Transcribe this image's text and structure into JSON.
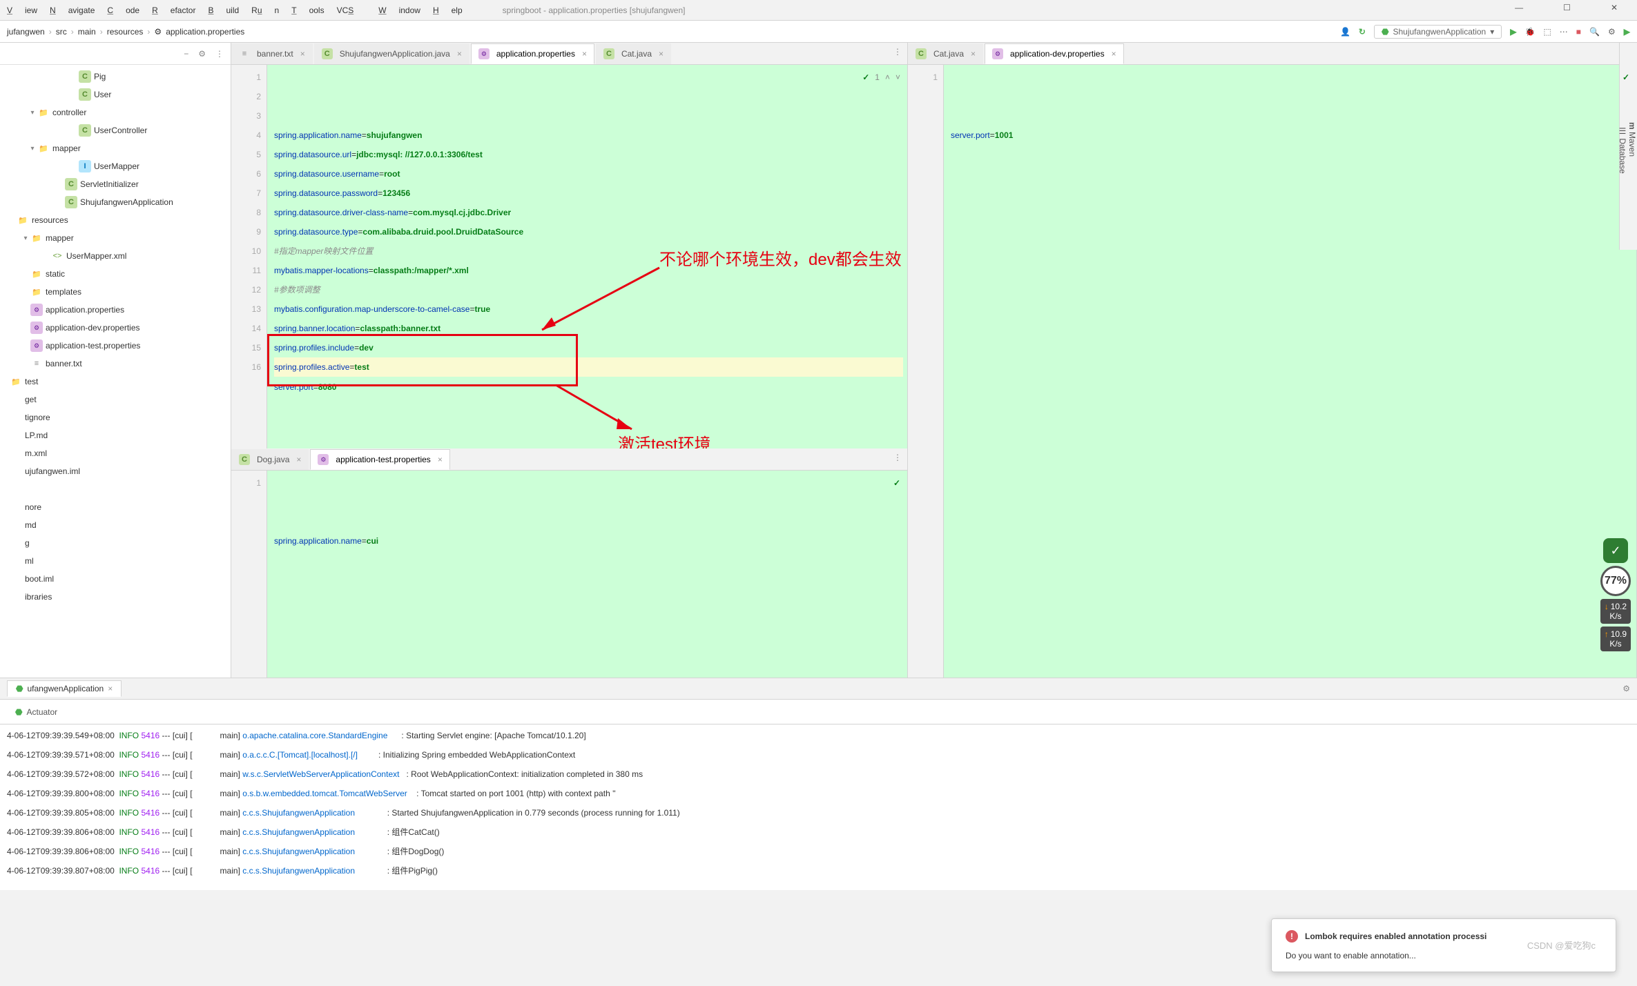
{
  "menubar": {
    "items": [
      "View",
      "Navigate",
      "Code",
      "Refactor",
      "Build",
      "Run",
      "Tools",
      "VCS",
      "Window",
      "Help"
    ],
    "title": "springboot - application.properties [shujufangwen]"
  },
  "win_controls": {
    "min": "—",
    "max": "☐",
    "close": "✕"
  },
  "breadcrumb": {
    "items": [
      "jufangwen",
      "src",
      "main",
      "resources",
      "application.properties"
    ],
    "icon": "⚙"
  },
  "toolbar": {
    "run_config": "ShujufangwenApplication",
    "icons": [
      "▶",
      "⟳",
      "⤓",
      "⋯",
      "■",
      "🔍",
      "⚙",
      "▶"
    ]
  },
  "tree": {
    "header_icons": [
      "−",
      "⚙",
      "⋮"
    ],
    "items": [
      {
        "indent": 100,
        "icon": "C",
        "iconClass": "ic-class",
        "label": "Pig"
      },
      {
        "indent": 100,
        "icon": "C",
        "iconClass": "ic-class",
        "label": "User"
      },
      {
        "indent": 40,
        "exp": "▾",
        "icon": "📁",
        "iconClass": "ic-pkg",
        "label": "controller"
      },
      {
        "indent": 100,
        "icon": "C",
        "iconClass": "ic-class",
        "label": "UserController"
      },
      {
        "indent": 40,
        "exp": "▾",
        "icon": "📁",
        "iconClass": "ic-pkg",
        "label": "mapper"
      },
      {
        "indent": 100,
        "icon": "I",
        "iconClass": "ic-interface",
        "label": "UserMapper"
      },
      {
        "indent": 80,
        "icon": "C",
        "iconClass": "ic-class",
        "label": "ServletInitializer"
      },
      {
        "indent": 80,
        "icon": "C",
        "iconClass": "ic-class",
        "label": "ShujufangwenApplication"
      },
      {
        "indent": 10,
        "exp": "",
        "icon": "📁",
        "iconClass": "ic-folder",
        "label": "resources",
        "sel": false,
        "resourceRoot": true
      },
      {
        "indent": 30,
        "exp": "▾",
        "icon": "📁",
        "iconClass": "ic-folder",
        "label": "mapper"
      },
      {
        "indent": 60,
        "icon": "<>",
        "iconClass": "ic-xml",
        "label": "UserMapper.xml"
      },
      {
        "indent": 30,
        "icon": "📁",
        "iconClass": "ic-folder",
        "label": "static"
      },
      {
        "indent": 30,
        "icon": "📁",
        "iconClass": "ic-folder",
        "label": "templates"
      },
      {
        "indent": 30,
        "icon": "⚙",
        "iconClass": "ic-prop",
        "label": "application.properties"
      },
      {
        "indent": 30,
        "icon": "⚙",
        "iconClass": "ic-prop",
        "label": "application-dev.properties"
      },
      {
        "indent": 30,
        "icon": "⚙",
        "iconClass": "ic-prop",
        "label": "application-test.properties"
      },
      {
        "indent": 30,
        "icon": "≡",
        "iconClass": "ic-txt",
        "label": "banner.txt"
      },
      {
        "indent": 0,
        "icon": "📁",
        "iconClass": "ic-folder",
        "label": "test"
      },
      {
        "indent": 0,
        "icon": "",
        "iconClass": "",
        "label": "get"
      },
      {
        "indent": 0,
        "icon": "",
        "iconClass": "",
        "label": "tignore"
      },
      {
        "indent": 0,
        "icon": "",
        "iconClass": "",
        "label": "LP.md"
      },
      {
        "indent": 0,
        "icon": "",
        "iconClass": "",
        "label": "m.xml"
      },
      {
        "indent": 0,
        "icon": "",
        "iconClass": "",
        "label": "ujufangwen.iml"
      },
      {
        "indent": 0,
        "icon": "",
        "iconClass": "",
        "label": ""
      },
      {
        "indent": 0,
        "icon": "",
        "iconClass": "",
        "label": "nore"
      },
      {
        "indent": 0,
        "icon": "",
        "iconClass": "",
        "label": "md"
      },
      {
        "indent": 0,
        "icon": "",
        "iconClass": "",
        "label": "g"
      },
      {
        "indent": 0,
        "icon": "",
        "iconClass": "",
        "label": "ml"
      },
      {
        "indent": 0,
        "icon": "",
        "iconClass": "",
        "label": "boot.iml"
      },
      {
        "indent": 0,
        "icon": "",
        "iconClass": "",
        "label": "ibraries"
      }
    ]
  },
  "tabs_left": [
    {
      "icon": "≡",
      "label": "banner.txt",
      "active": false
    },
    {
      "icon": "C",
      "label": "ShujufangwenApplication.java",
      "active": false
    },
    {
      "icon": "⚙",
      "label": "application.properties",
      "active": true
    },
    {
      "icon": "C",
      "label": "Cat.java",
      "active": false
    }
  ],
  "tabs_right": [
    {
      "icon": "C",
      "label": "Cat.java",
      "active": false
    },
    {
      "icon": "⚙",
      "label": "application-dev.properties",
      "active": true
    }
  ],
  "tabs_bottom": [
    {
      "icon": "C",
      "label": "Dog.java",
      "active": false
    },
    {
      "icon": "⚙",
      "label": "application-test.properties",
      "active": true
    }
  ],
  "code_main": {
    "status": {
      "check": "✓",
      "count": "1",
      "up": "˄",
      "down": "˅"
    },
    "lines": [
      {
        "n": 1,
        "k": "spring.application.name",
        "v": "shujufangwen"
      },
      {
        "n": 2,
        "k": "spring.datasource.url",
        "v": "jdbc:mysql: //127.0.0.1:3306/test"
      },
      {
        "n": 3,
        "k": "spring.datasource.username",
        "v": "root"
      },
      {
        "n": 4,
        "k": "spring.datasource.password",
        "v": "123456"
      },
      {
        "n": 5,
        "k": "spring.datasource.driver-class-name",
        "v": "com.mysql.cj.jdbc.Driver"
      },
      {
        "n": 6,
        "k": "spring.datasource.type",
        "v": "com.alibaba.druid.pool.DruidDataSource"
      },
      {
        "n": 7,
        "comment": "#指定mapper映射文件位置"
      },
      {
        "n": 8,
        "k": "mybatis.mapper-locations",
        "v": "classpath:/mapper/*.xml"
      },
      {
        "n": 9,
        "comment": "#参数项调整"
      },
      {
        "n": 10,
        "k": "mybatis.configuration.map-underscore-to-camel-case",
        "v": "true"
      },
      {
        "n": 11,
        "k": "spring.banner.location",
        "v": "classpath:banner.txt"
      },
      {
        "n": 12,
        "k": "spring.profiles.include",
        "v": "dev"
      },
      {
        "n": 13,
        "k": "spring.profiles.active",
        "v": "test",
        "current": true
      },
      {
        "n": 14,
        "k": "server.port",
        "v": "8080"
      },
      {
        "n": 15,
        "blank": true
      },
      {
        "n": 16,
        "blank": true
      }
    ]
  },
  "code_right": {
    "lines": [
      {
        "n": 1,
        "k": "server.port",
        "v": "1001"
      }
    ],
    "check": "✓"
  },
  "code_bottom": {
    "lines": [
      {
        "n": 1,
        "k": "spring.application.name",
        "v": "cui"
      }
    ],
    "check": "✓"
  },
  "annotations": {
    "text1": "不论哪个环境生效，dev都会生效",
    "text2": "激活test环境"
  },
  "run_tab": {
    "label": "ufangwenApplication"
  },
  "status_tab": {
    "icon": "⬣",
    "label": "Actuator"
  },
  "console": {
    "rows": [
      {
        "t": "4-06-12T09:39:39.549+08:00",
        "lv": "INFO",
        "pid": "5416",
        "th": "--- [cui] [",
        "thr": "main]",
        "lg": "o.apache.catalina.core.StandardEngine",
        "m": ": Starting Servlet engine: [Apache Tomcat/10.1.20]"
      },
      {
        "t": "4-06-12T09:39:39.571+08:00",
        "lv": "INFO",
        "pid": "5416",
        "th": "--- [cui] [",
        "thr": "main]",
        "lg": "o.a.c.c.C.[Tomcat].[localhost].[/]",
        "m": ": Initializing Spring embedded WebApplicationContext"
      },
      {
        "t": "4-06-12T09:39:39.572+08:00",
        "lv": "INFO",
        "pid": "5416",
        "th": "--- [cui] [",
        "thr": "main]",
        "lg": "w.s.c.ServletWebServerApplicationContext",
        "m": ": Root WebApplicationContext: initialization completed in 380 ms"
      },
      {
        "t": "4-06-12T09:39:39.800+08:00",
        "lv": "INFO",
        "pid": "5416",
        "th": "--- [cui] [",
        "thr": "main]",
        "lg": "o.s.b.w.embedded.tomcat.TomcatWebServer",
        "m": ": Tomcat started on port 1001 (http) with context path ''"
      },
      {
        "t": "4-06-12T09:39:39.805+08:00",
        "lv": "INFO",
        "pid": "5416",
        "th": "--- [cui] [",
        "thr": "main]",
        "lg": "c.c.s.ShujufangwenApplication",
        "m": ": Started ShujufangwenApplication in 0.779 seconds (process running for 1.011)"
      },
      {
        "t": "4-06-12T09:39:39.806+08:00",
        "lv": "INFO",
        "pid": "5416",
        "th": "--- [cui] [",
        "thr": "main]",
        "lg": "c.c.s.ShujufangwenApplication",
        "m": ": 组件CatCat()"
      },
      {
        "t": "4-06-12T09:39:39.806+08:00",
        "lv": "INFO",
        "pid": "5416",
        "th": "--- [cui] [",
        "thr": "main]",
        "lg": "c.c.s.ShujufangwenApplication",
        "m": ": 组件DogDog()"
      },
      {
        "t": "4-06-12T09:39:39.807+08:00",
        "lv": "INFO",
        "pid": "5416",
        "th": "--- [cui] [",
        "thr": "main]",
        "lg": "c.c.s.ShujufangwenApplication",
        "m": ": 组件PigPig()"
      }
    ]
  },
  "notification": {
    "title": "Lombok requires enabled annotation processi",
    "body": "Do you want to enable annotation..."
  },
  "side_widget": {
    "shield": "✓",
    "percent": "77%",
    "stat1_v": "10.2",
    "stat1_u": "K/s",
    "stat2_v": "10.9",
    "stat2_u": "K/s"
  },
  "right_rail": {
    "items": [
      "m",
      "Maven",
      "☰",
      "Database"
    ]
  },
  "watermark": "CSDN @爱吃狗c"
}
